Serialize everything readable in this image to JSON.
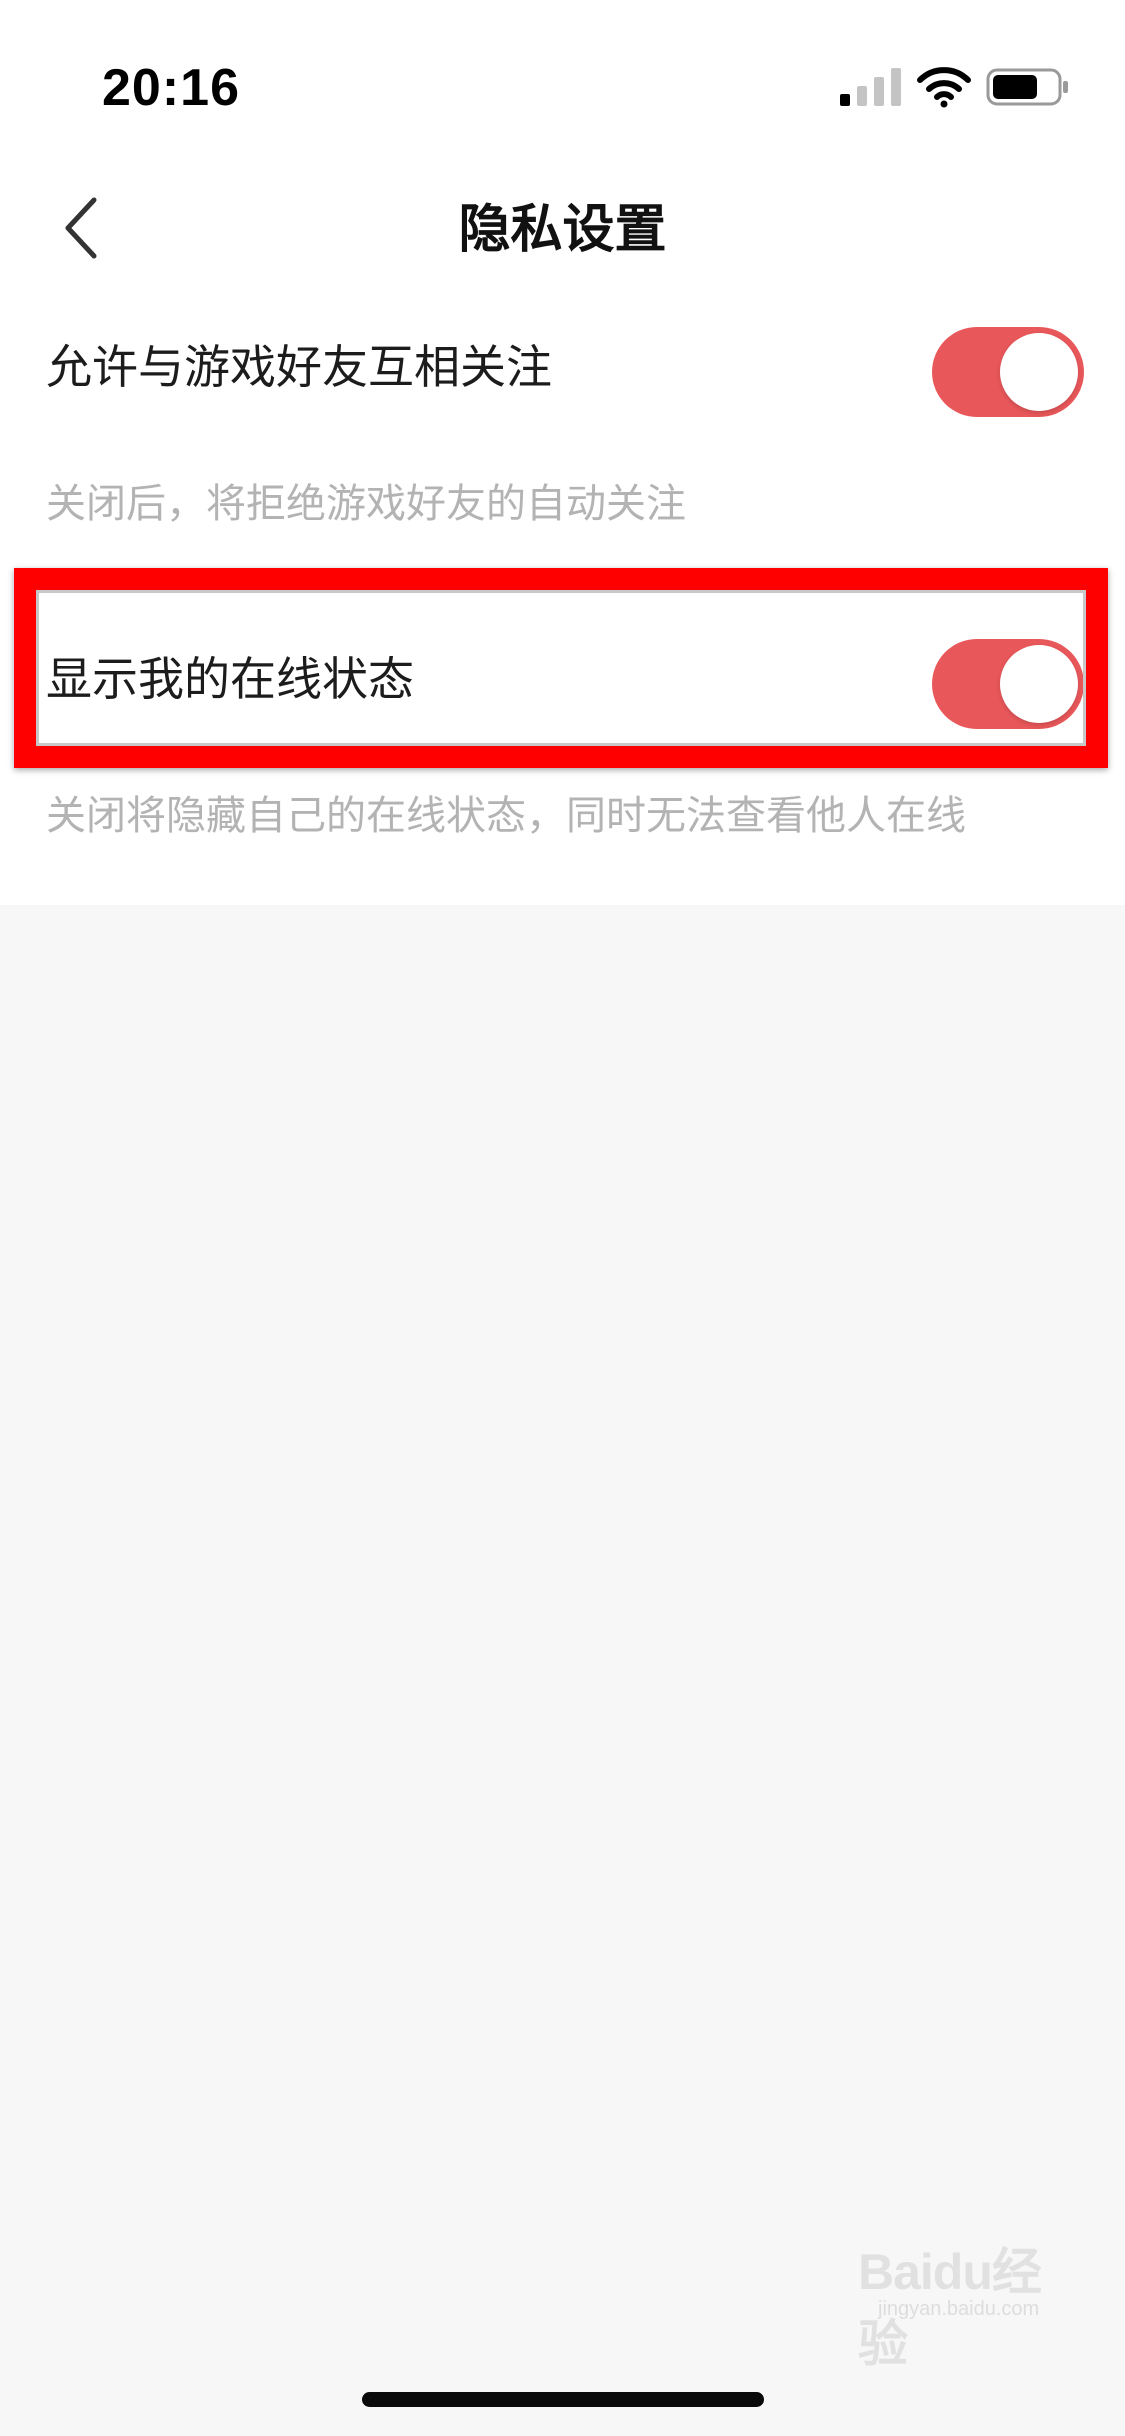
{
  "status_bar": {
    "time": "20:16",
    "signal_icon": "cellular-signal-icon",
    "wifi_icon": "wifi-icon",
    "battery_icon": "battery-icon",
    "signal_bars_active": 1,
    "battery_level": 0.65
  },
  "nav": {
    "back_icon": "chevron-left-icon",
    "title": "隐私设置"
  },
  "settings": [
    {
      "label": "允许与游戏好友互相关注",
      "enabled": true,
      "description": "关闭后，将拒绝游戏好友的自动关注"
    },
    {
      "label": "显示我的在线状态",
      "enabled": true,
      "description": "关闭将隐藏自己的在线状态，同时无法查看他人在线"
    }
  ],
  "watermark": {
    "text": "Baidu经验",
    "sub": "jingyan.baidu.com"
  },
  "colors": {
    "toggle_on": "#e8575a",
    "highlight": "#ff0000",
    "description_text": "#b3b3b3",
    "page_bg": "#f7f7f7"
  }
}
